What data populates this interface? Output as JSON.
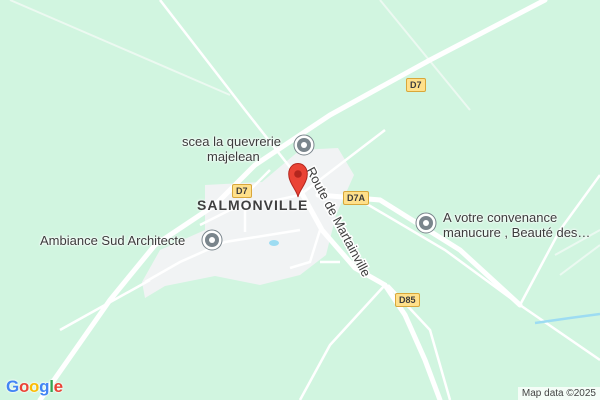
{
  "map": {
    "town": "SALMONVILLE",
    "route_shields": [
      "D7",
      "D7",
      "D7A",
      "D85"
    ],
    "street_label": "Route de Martainville",
    "pois": [
      {
        "name": "scea la quevrerie majelean",
        "icon": "poi-circle-icon"
      },
      {
        "name": "Ambiance Sud Architecte",
        "icon": "poi-circle-icon"
      },
      {
        "name": "A votre convenance manucure , Beauté des…",
        "icon": "poi-circle-icon"
      }
    ],
    "poi_text": {
      "scea_line1": "scea la quevrerie",
      "scea_line2": "majelean",
      "ambiance": "Ambiance Sud Architecte",
      "convenance_line1": "A votre convenance",
      "convenance_line2": "manucure , Beauté des…"
    },
    "marker_icon": "red-pin-icon",
    "logo": "Google",
    "attribution": "Map data ©2025",
    "colors": {
      "land": "#d1f5e0",
      "builtup": "#f1f3f4",
      "road": "#ffffff",
      "water": "#9ddcf2",
      "marker": "#ea4335"
    }
  }
}
